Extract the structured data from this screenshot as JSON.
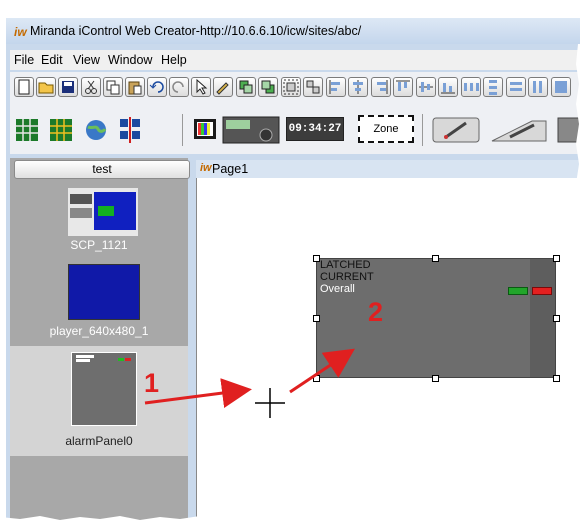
{
  "window": {
    "title": "Miranda iControl Web Creator-http://10.6.6.10/icw/sites/abc/",
    "app_icon": "iw"
  },
  "menu": [
    "File",
    "Edit",
    "View",
    "Window",
    "Help"
  ],
  "toolbar2": {
    "clock": "09:34:27",
    "zone": "Zone"
  },
  "left_panel": {
    "group_button": "test",
    "items": [
      {
        "label": "SCP_1121"
      },
      {
        "label": "player_640x480_1"
      },
      {
        "label": "alarmPanel0",
        "selected": true
      }
    ]
  },
  "page_tab": {
    "icon": "iw",
    "title": "Page1"
  },
  "alarm_panel": {
    "line1": "LATCHED",
    "line2": "CURRENT",
    "line3": "Overall",
    "indicator_colors": [
      "#22a52a",
      "#e32020"
    ]
  },
  "annotations": {
    "step1": "1",
    "step2": "2",
    "cursor": "+",
    "arrow_color": "#e02020"
  }
}
